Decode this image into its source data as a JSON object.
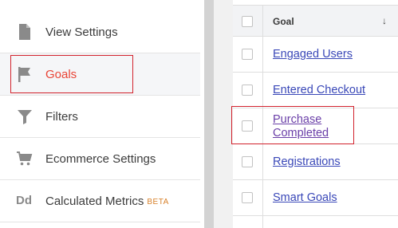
{
  "menu": {
    "items": [
      {
        "label": "View Settings",
        "icon": "document-icon"
      },
      {
        "label": "Goals",
        "icon": "flag-icon",
        "active": true
      },
      {
        "label": "Filters",
        "icon": "filter-icon"
      },
      {
        "label": "Ecommerce Settings",
        "icon": "cart-icon"
      },
      {
        "label": "Calculated Metrics",
        "badge": "BETA",
        "icon": "dd-icon",
        "icon_text": "Dd"
      }
    ]
  },
  "goals_table": {
    "column_header": "Goal",
    "sort_indicator": "↓",
    "rows": [
      {
        "name": "Engaged Users"
      },
      {
        "name": "Entered Checkout"
      },
      {
        "name": "Purchase Completed"
      },
      {
        "name": "Registrations"
      },
      {
        "name": "Smart Goals"
      }
    ]
  },
  "colors": {
    "active_label": "#e94436",
    "highlight_box": "#d2222d",
    "link": "#3a48b8",
    "visited_link": "#6a3fa8",
    "beta_badge": "#d8812b"
  }
}
